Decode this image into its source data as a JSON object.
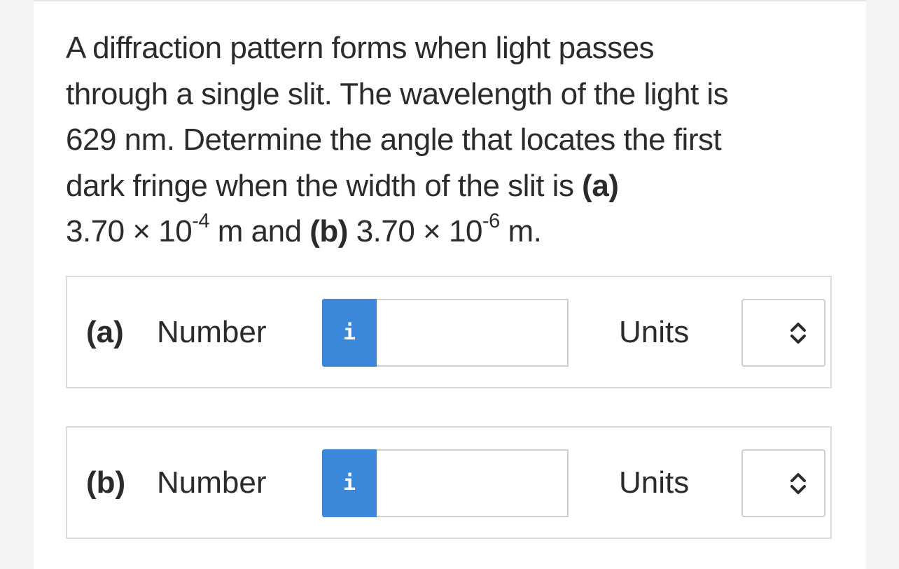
{
  "question": {
    "line1": "A diffraction pattern forms when light passes",
    "line2": "through a single slit. The wavelength of the light is",
    "line3": "629 nm. Determine the angle that locates the first",
    "line4_text": "dark fringe when the width of the slit is ",
    "line4_part": "(a)",
    "line5_a_mantissa": "3.70 × 10",
    "line5_a_exponent": "-4",
    "line5_a_unit_and": " m and ",
    "line5_b_part": "(b)",
    "line5_b_mantissa": " 3.70 × 10",
    "line5_b_exponent": "-6",
    "line5_b_unit": " m."
  },
  "answers": [
    {
      "part_label": "(a)",
      "number_label": "Number",
      "info_icon": "i",
      "number_value": "",
      "units_label": "Units",
      "units_value": ""
    },
    {
      "part_label": "(b)",
      "number_label": "Number",
      "info_icon": "i",
      "number_value": "",
      "units_label": "Units",
      "units_value": ""
    }
  ],
  "colors": {
    "info_button": "#3b87d9",
    "text": "#2b2b2b",
    "border": "#dcdcdc"
  },
  "icons": {
    "info": "info-icon",
    "units_dropdown": "chevron-updown-icon"
  }
}
